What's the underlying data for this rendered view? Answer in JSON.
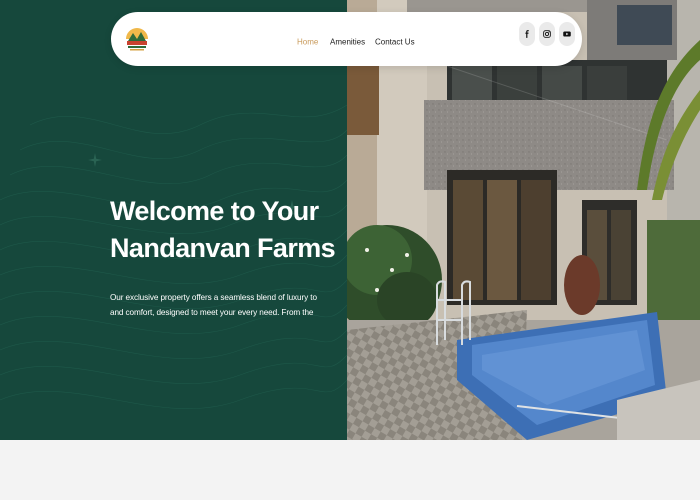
{
  "nav": {
    "logo_icon": "nandanvan-farms-logo",
    "links": [
      {
        "label": "Home",
        "active": true
      },
      {
        "label": "Amenities",
        "active": false
      },
      {
        "label": "Contact Us",
        "active": false
      }
    ],
    "social": [
      {
        "icon": "facebook-icon"
      },
      {
        "icon": "instagram-icon"
      },
      {
        "icon": "youtube-icon"
      }
    ]
  },
  "hero": {
    "title_line1": "Welcome to Your",
    "title_line2": "Nandanvan Farms",
    "description": "Our exclusive property offers a seamless blend of luxury to and comfort, designed to meet your every need. From the",
    "panel_color": "#16483c",
    "accent_color": "#c99a5b"
  }
}
